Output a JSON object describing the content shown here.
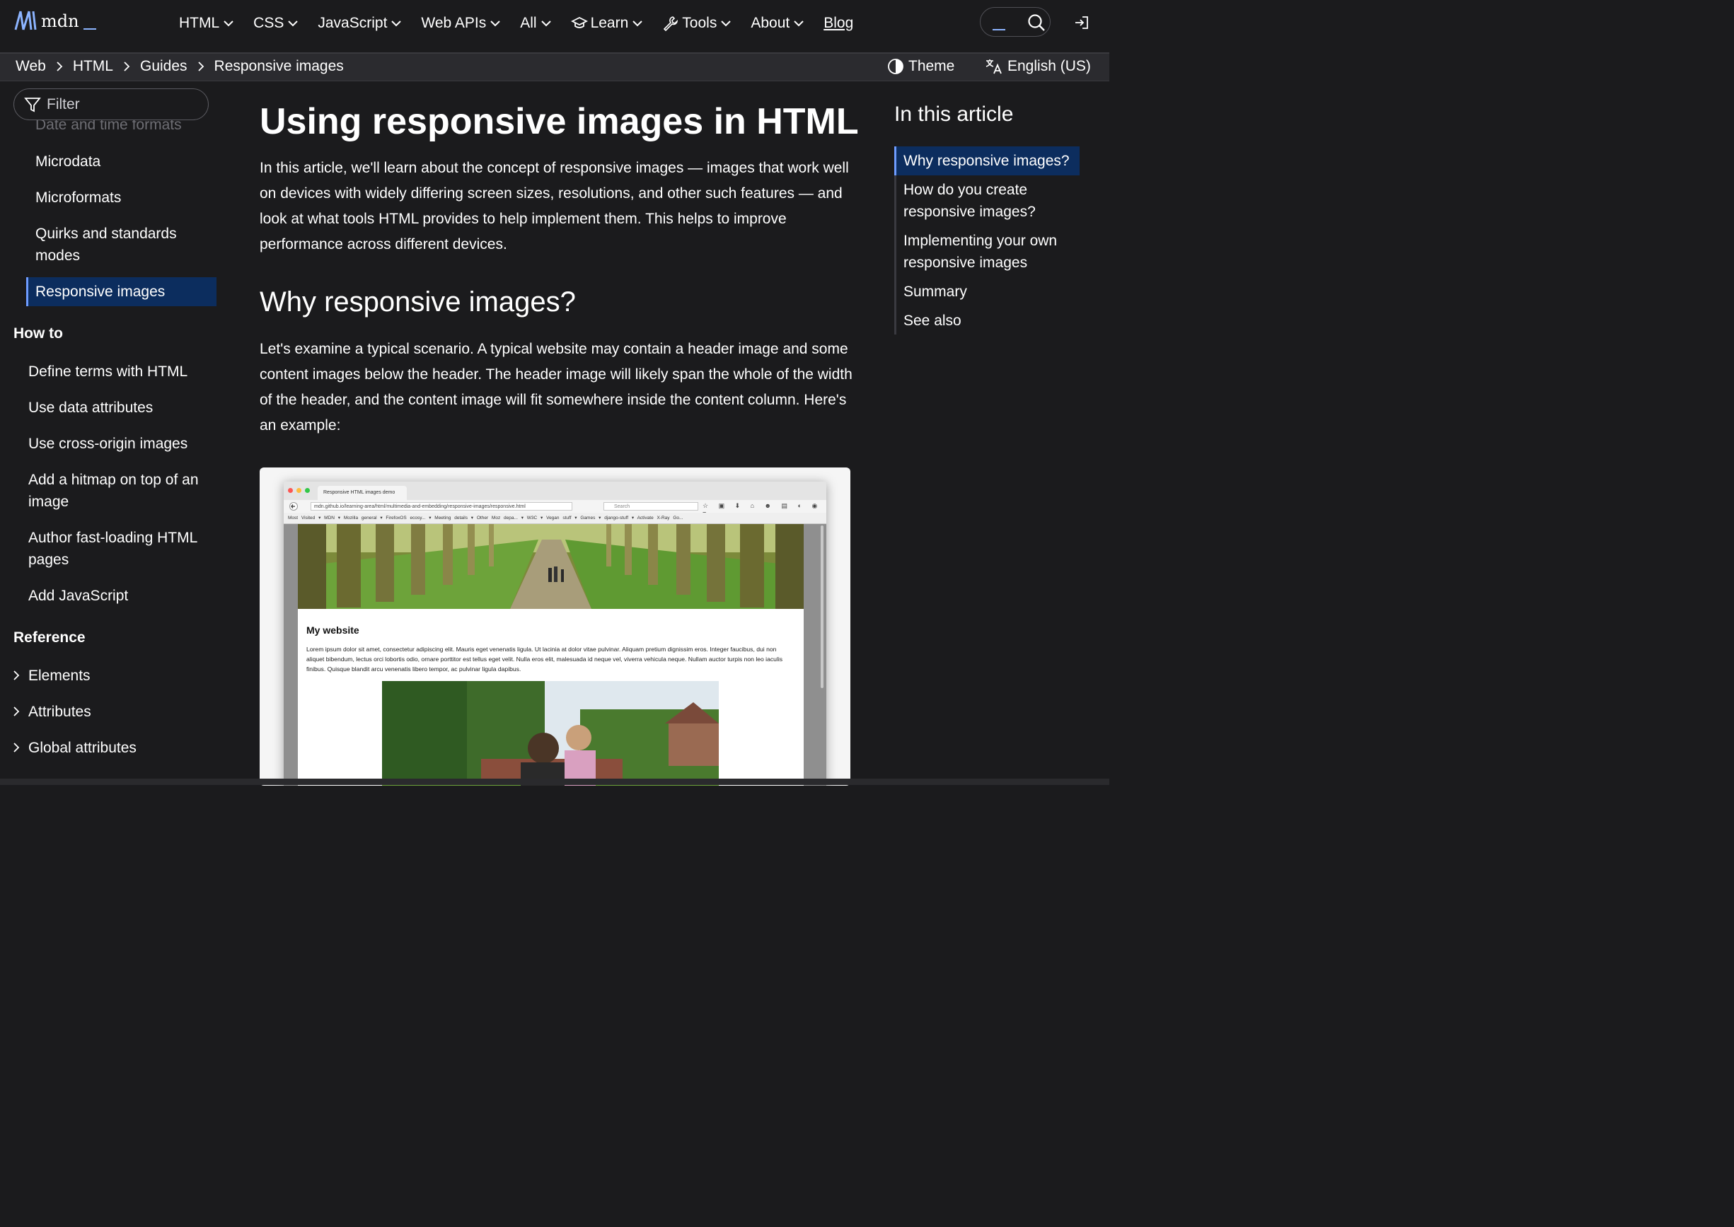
{
  "nav": {
    "logo_text": "mdn",
    "menu": [
      {
        "label": "HTML"
      },
      {
        "label": "CSS"
      },
      {
        "label": "JavaScript"
      },
      {
        "label": "Web APIs"
      },
      {
        "label": "All"
      },
      {
        "label": "Learn"
      },
      {
        "label": "Tools"
      },
      {
        "label": "About"
      }
    ],
    "blog_label": "Blog"
  },
  "breadcrumbs": [
    "Web",
    "HTML",
    "Guides",
    "Responsive images"
  ],
  "theme_label": "Theme",
  "language_label": "English (US)",
  "sidebar": {
    "filter_placeholder": "Filter",
    "faded_item": "Date and time formats",
    "items": [
      "Microdata",
      "Microformats",
      "Quirks and standards modes",
      "Responsive images"
    ],
    "active_item": "Responsive images",
    "howto_heading": "How to",
    "howto_items": [
      "Define terms with HTML",
      "Use data attributes",
      "Use cross-origin images",
      "Add a hitmap on top of an image",
      "Author fast-loading HTML pages",
      "Add JavaScript"
    ],
    "reference_heading": "Reference",
    "reference_items": [
      "Elements",
      "Attributes",
      "Global attributes"
    ]
  },
  "article": {
    "title": "Using responsive images in HTML",
    "intro": "In this article, we'll learn about the concept of responsive images — images that work well on devices with widely differing screen sizes, resolutions, and other such features — and look at what tools HTML provides to help implement them. This helps to improve performance across different devices.",
    "h2": "Why responsive images?",
    "p2": "Let's examine a typical scenario. A typical website may contain a header image and some content images below the header. The header image will likely span the whole of the width of the header, and the content image will fit somewhere inside the content column. Here's an example:",
    "figure": {
      "tab_title": "Responsive HTML images demo",
      "url": "mdn.github.io/learning-area/html/multimedia-and-embedding/responsive-images/responsive.html",
      "search_placeholder": "Search",
      "bookmarks": "Most Visited ▾  MDN ▾  Mozilla general ▾  FirefoxOS ecosy... ▾  Meeting details ▾  Other Moz depa... ▾  W3C ▾  Vegan stuff ▾  Games ▾  django-stuff ▾  Activate X-Ray Go...",
      "site_title": "My website",
      "lorem": "Lorem ipsum dolor sit amet, consectetur adipiscing elit. Mauris eget venenatis ligula. Ut lacinia at dolor vitae pulvinar. Aliquam pretium dignissim eros. Integer faucibus, dui non aliquet bibendum, lectus orci lobortis odio, ornare porttitor est tellus eget velit. Nulla eros elit, malesuada id neque vel, viverra vehicula neque. Nullam auctor turpis non leo iaculis finibus. Quisque blandit arcu venenatis libero tempor, ac pulvinar ligula dapibus."
    }
  },
  "toc": {
    "title": "In this article",
    "items": [
      "Why responsive images?",
      "How do you create responsive images?",
      "Implementing your own responsive images",
      "Summary",
      "See also"
    ],
    "active": "Why responsive images?"
  },
  "colors": {
    "background": "#1b1b1d",
    "active_bg": "#0c2d5e",
    "accent": "#6e9cff"
  }
}
